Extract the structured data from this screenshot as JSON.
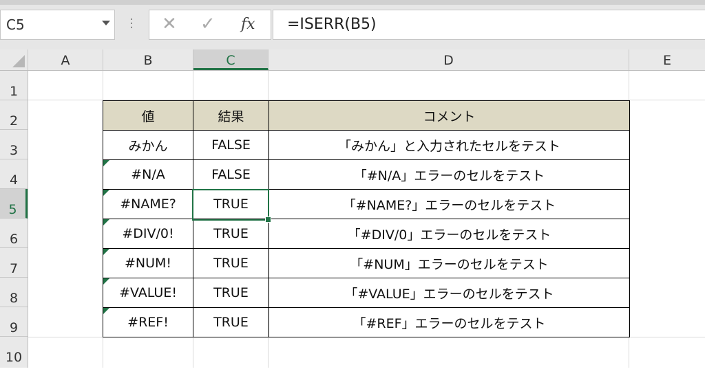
{
  "name_box": "C5",
  "formula": "=ISERR(B5)",
  "formula_buttons": {
    "cancel": "✕",
    "enter": "✓",
    "fx": "fx"
  },
  "columns": [
    "A",
    "B",
    "C",
    "D",
    "E"
  ],
  "rows": [
    "1",
    "2",
    "3",
    "4",
    "5",
    "6",
    "7",
    "8",
    "9",
    "10"
  ],
  "selected_cell": "C5",
  "table": {
    "headers": [
      "値",
      "結果",
      "コメント"
    ],
    "rows": [
      [
        "みかん",
        "FALSE",
        "「みかん」と入力されたセルをテスト"
      ],
      [
        "#N/A",
        "FALSE",
        "「#N/A」エラーのセルをテスト"
      ],
      [
        "#NAME?",
        "TRUE",
        "「#NAME?」エラーのセルをテスト"
      ],
      [
        "#DIV/0!",
        "TRUE",
        "「#DIV/0」エラーのセルをテスト"
      ],
      [
        "#NUM!",
        "TRUE",
        "「#NUM」エラーのセルをテスト"
      ],
      [
        "#VALUE!",
        "TRUE",
        "「#VALUE」エラーのセルをテスト"
      ],
      [
        "#REF!",
        "TRUE",
        "「#REF」エラーのセルをテスト"
      ]
    ]
  },
  "colors": {
    "header_fill": "#ddd9c4",
    "accent": "#217346"
  }
}
